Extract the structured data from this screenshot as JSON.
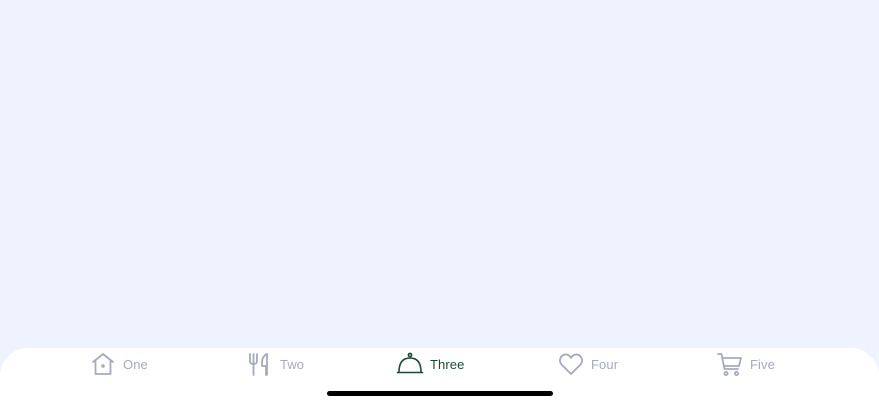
{
  "colors": {
    "background": "#eff3fd",
    "tab_bar_background": "#ffffff",
    "inactive": "#a6a9c0",
    "active": "#1a4a30",
    "home_indicator": "#000000"
  },
  "tabs": [
    {
      "label": "One",
      "icon": "home-icon",
      "active": false
    },
    {
      "label": "Two",
      "icon": "utensils-icon",
      "active": false
    },
    {
      "label": "Three",
      "icon": "cloche-icon",
      "active": true
    },
    {
      "label": "Four",
      "icon": "heart-icon",
      "active": false
    },
    {
      "label": "Five",
      "icon": "cart-icon",
      "active": false
    }
  ]
}
